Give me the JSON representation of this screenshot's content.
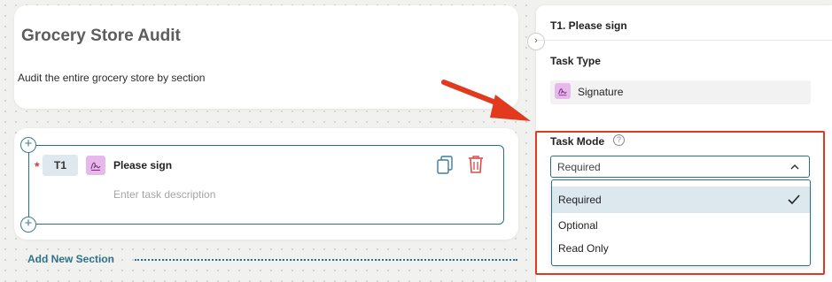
{
  "form": {
    "title": "Grocery Store Audit",
    "description": "Audit the entire grocery store by section"
  },
  "task": {
    "required_marker": "*",
    "number": "T1",
    "name": "Please sign",
    "description_placeholder": "Enter task description",
    "icon": "signature-icon"
  },
  "canvas": {
    "add_section_label": "Add New Section",
    "add_icon": "+"
  },
  "panel": {
    "title": "T1. Please sign",
    "collapse_icon": "›",
    "task_type_label": "Task Type",
    "task_type_value": "Signature",
    "task_mode_label": "Task Mode",
    "help_icon": "?",
    "task_mode_value": "Required",
    "options": [
      "Required",
      "Optional",
      "Read Only"
    ],
    "selected_option": "Required"
  },
  "colors": {
    "accent": "#2b6f83",
    "signature_icon_bg": "#e7b9ea",
    "delete_red": "#d94a4a",
    "annotation_red": "#e13a1f",
    "selected_row": "#dde8ee"
  }
}
